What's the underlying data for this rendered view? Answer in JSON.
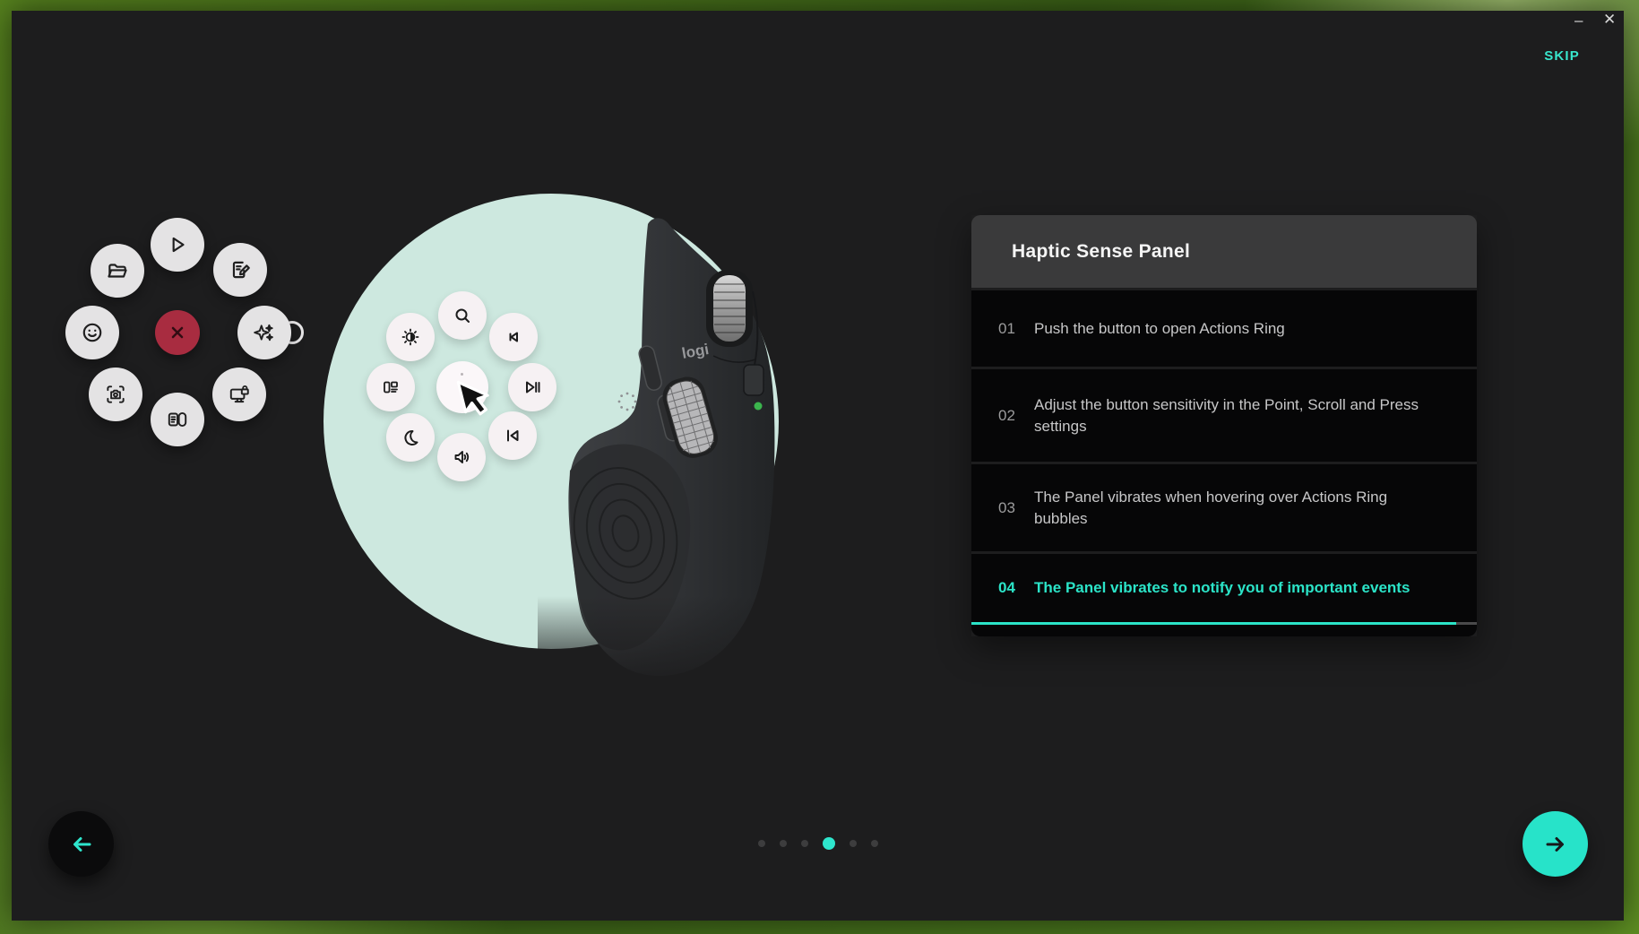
{
  "window": {
    "controls": {
      "minimize_glyph": "–",
      "close_glyph": "✕"
    },
    "skip_label": "SKIP"
  },
  "panel": {
    "title": "Haptic Sense Panel",
    "steps": [
      {
        "number": "01",
        "text": "Push the button to open Actions Ring",
        "active": false
      },
      {
        "number": "02",
        "text": "Adjust the button sensitivity in the Point, Scroll and Press settings",
        "active": false
      },
      {
        "number": "03",
        "text": "The Panel vibrates when hovering over Actions Ring bubbles",
        "active": false
      },
      {
        "number": "04",
        "text": "The Panel vibrates to notify you of important events",
        "active": true
      }
    ],
    "progress_percent": 96
  },
  "actions_ring": {
    "center_icon": "close-x-icon",
    "bubble_icons": [
      "play-icon",
      "note-edit-icon",
      "ai-sparkles-icon",
      "screen-lock-icon",
      "mouse-settings-icon",
      "screenshot-camera-icon",
      "emoji-smiley-icon",
      "folder-icon"
    ]
  },
  "media_ring": {
    "bubble_icons": [
      "search-icon",
      "skip-previous-icon",
      "play-pause-icon",
      "skip-to-start-icon",
      "volume-icon",
      "night-mode-moon-icon",
      "window-layout-icon",
      "brightness-icon"
    ],
    "center_icon": "cursor-pointer-icon"
  },
  "mouse": {
    "logo_text": "logi"
  },
  "pagination": {
    "count": 6,
    "active_index": 4
  },
  "footer": {
    "back_icon": "back-arrow-icon",
    "next_icon": "next-arrow-icon"
  },
  "colors": {
    "accent_teal": "#2be4c8",
    "danger_red": "#a82c40",
    "mint_circle": "#cde8df",
    "window_bg": "#1d1d1e",
    "panel_header_bg": "#3a3a3b",
    "panel_row_bg": "#060607",
    "status_led_green": "#3bb54d"
  }
}
